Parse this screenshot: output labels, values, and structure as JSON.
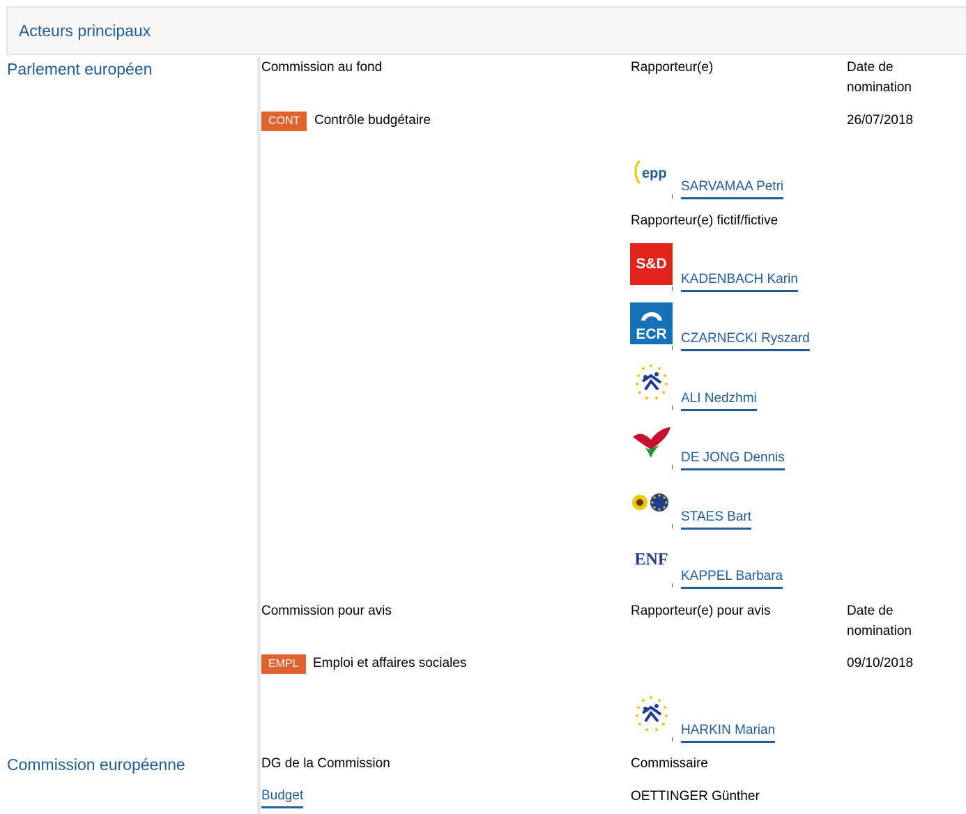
{
  "panel": {
    "title": "Acteurs principaux"
  },
  "parliament": {
    "label": "Parlement européen",
    "lead": {
      "col_committee": "Commission au fond",
      "col_rapporteur": "Rapporteur(e)",
      "col_date_line1": "Date de",
      "col_date_line2": "nomination",
      "committee_code": "CONT",
      "committee_name": "Contrôle budgétaire",
      "date": "26/07/2018",
      "rapporteur": {
        "name": "SARVAMAA Petri",
        "group_icon": "epp-logo-icon"
      },
      "shadow_label": "Rapporteur(e) fictif/fictive",
      "shadows": [
        {
          "name": "KADENBACH Karin",
          "group_icon": "sd-logo-icon"
        },
        {
          "name": "CZARNECKI Ryszard",
          "group_icon": "ecr-logo-icon"
        },
        {
          "name": "ALI Nedzhmi",
          "group_icon": "alde-logo-icon"
        },
        {
          "name": "DE JONG Dennis",
          "group_icon": "gue-ngl-logo-icon"
        },
        {
          "name": "STAES Bart",
          "group_icon": "greens-efa-logo-icon"
        },
        {
          "name": "KAPPEL Barbara",
          "group_icon": "enf-logo-icon"
        }
      ]
    },
    "opinion": {
      "col_committee": "Commission pour avis",
      "col_rapporteur": "Rapporteur(e) pour avis",
      "col_date_line1": "Date de",
      "col_date_line2": "nomination",
      "committee_code": "EMPL",
      "committee_name": "Emploi et affaires sociales",
      "date": "09/10/2018",
      "rapporteur": {
        "name": "HARKIN Marian",
        "group_icon": "alde-logo-icon"
      }
    }
  },
  "commission": {
    "label": "Commission européenne",
    "col_dg": "DG de la Commission",
    "col_commissioner": "Commissaire",
    "dg": "Budget",
    "commissioner": "OETTINGER Günther"
  },
  "logos": {
    "sd_text": "S&D",
    "ecr_text": "ECR",
    "enf_text": "ENF",
    "epp_text": "epp"
  },
  "colors": {
    "link": "#1f5c99",
    "tag": "#e0632e",
    "sd_red": "#e2231a",
    "ecr_blue": "#1670b8"
  }
}
